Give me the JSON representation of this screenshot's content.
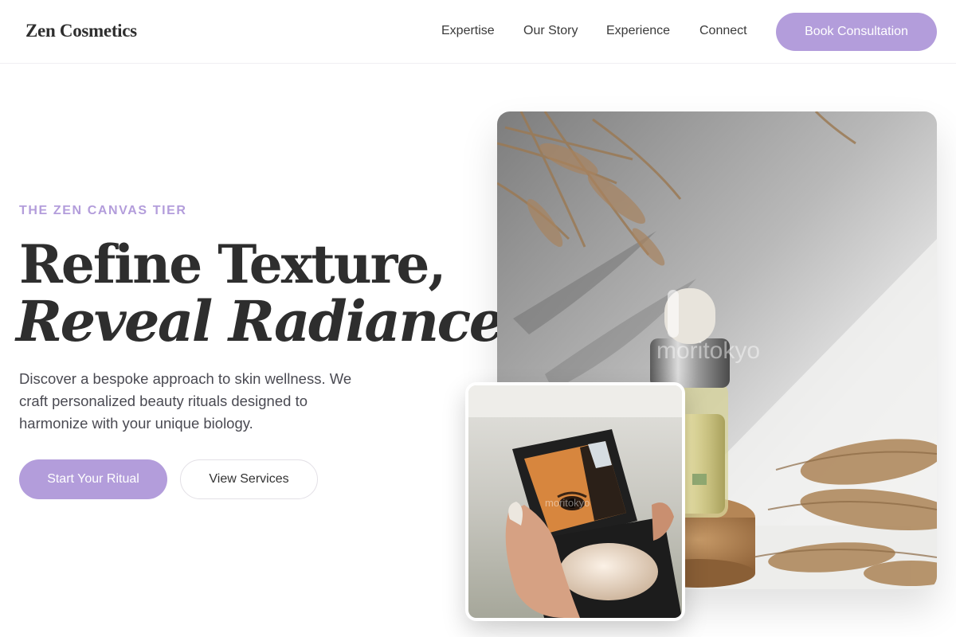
{
  "brand": {
    "name": "Zen Cosmetics"
  },
  "nav": {
    "items": [
      "Expertise",
      "Our Story",
      "Experience",
      "Connect"
    ],
    "cta": "Book Consultation"
  },
  "hero": {
    "eyebrow": "THE ZEN CANVAS TIER",
    "headline_line1": "Refine Texture,",
    "headline_line2": "Reveal Radiance.",
    "description": "Discover a bespoke approach to skin wellness. We craft personalized beauty rituals designed to harmonize with your unique biology.",
    "primary_button": "Start Your Ritual",
    "secondary_button": "View Services"
  },
  "images": {
    "main_watermark": "moritokyo",
    "secondary_watermark": "moritokyo"
  },
  "colors": {
    "accent": "#b39ddb",
    "text_dark": "#2e2e2e",
    "text_body": "#4a4a52"
  }
}
